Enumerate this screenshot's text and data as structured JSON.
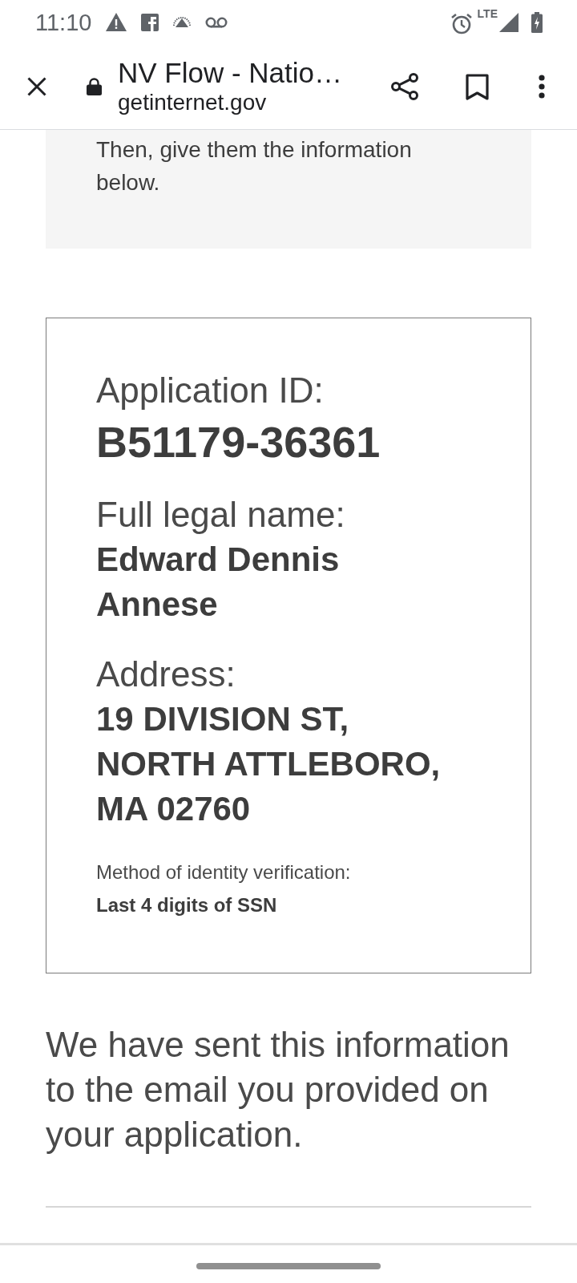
{
  "status_bar": {
    "time": "11:10",
    "network": "LTE"
  },
  "browser_toolbar": {
    "title": "NV Flow - Natio…",
    "url": "getinternet.gov"
  },
  "instructions": {
    "text": "Then, give them the information below."
  },
  "application_card": {
    "fields": [
      {
        "kind": "id",
        "label": "Application ID:",
        "value": "B51179-36361"
      },
      {
        "kind": "standard",
        "label": "Full legal name:",
        "value": "Edward Dennis Annese"
      },
      {
        "kind": "standard",
        "label": "Address:",
        "value": "19 DIVISION ST, NORTH ATTLEBORO, MA 02760"
      },
      {
        "kind": "small",
        "label": "Method of identity verification:",
        "value": "Last 4 digits of SSN"
      }
    ]
  },
  "confirmation": {
    "text": "We have sent this information to the email you provided on your application."
  }
}
